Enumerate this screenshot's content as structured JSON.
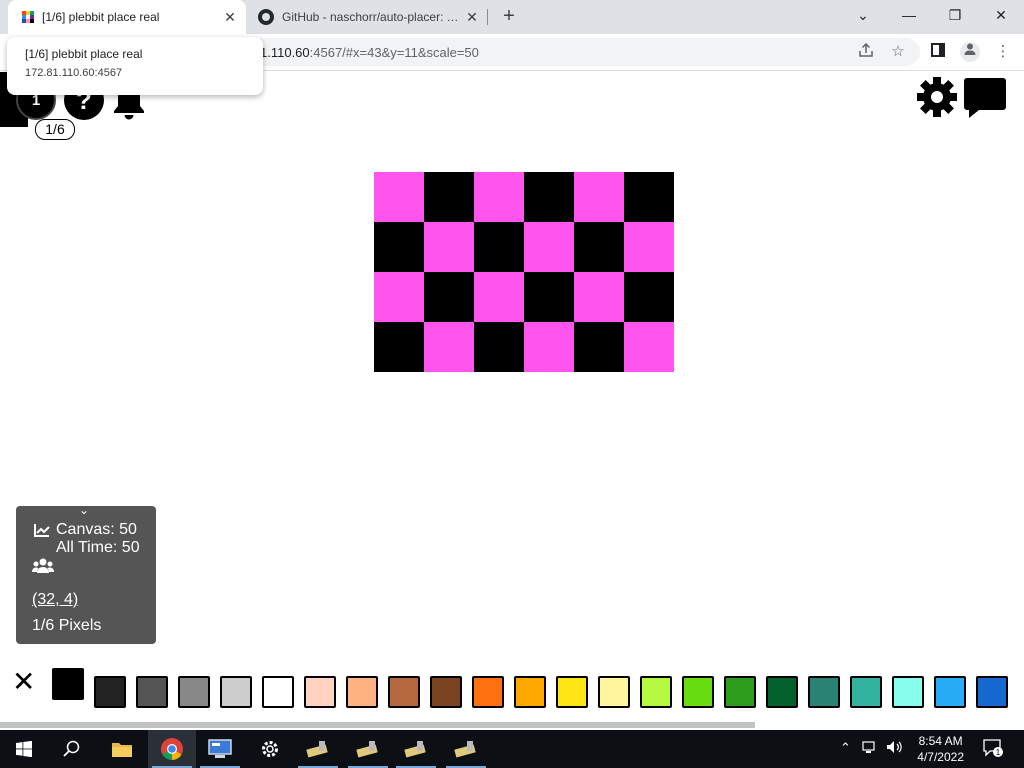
{
  "browser": {
    "tabs": [
      {
        "title": "[1/6] plebbit place real",
        "active": true
      },
      {
        "title": "GitHub - naschorr/auto-placer: Th",
        "active": false
      }
    ],
    "new_tab_label": "+",
    "close_glyph": "✕",
    "url_dim_prefix": "1.110.60",
    "url_rest": ":4567/#x=43&y=11&scale=50",
    "hover_card": {
      "title": "[1/6] plebbit place real",
      "url": "172.81.110.60:4567"
    },
    "window_controls": {
      "minimize": "—",
      "maximize": "❐",
      "close": "✕",
      "tab_list": "⌄"
    }
  },
  "page": {
    "account_label": "1",
    "help_label": "?",
    "pixel_badge": "1/6",
    "canvas": {
      "colors": {
        "pink": "#ff55ee",
        "black": "#000000"
      },
      "rows": [
        [
          "pink",
          "black",
          "pink",
          "black",
          "pink",
          "black"
        ],
        [
          "black",
          "pink",
          "black",
          "pink",
          "black",
          "pink"
        ],
        [
          "pink",
          "black",
          "pink",
          "black",
          "pink",
          "black"
        ],
        [
          "black",
          "pink",
          "black",
          "pink",
          "black",
          "pink"
        ]
      ]
    },
    "stats": {
      "canvas_line": "Canvas: 50",
      "alltime_line": "All Time: 50",
      "coords": "(32, 4)",
      "pixels": "1/6 Pixels"
    },
    "palette_close": "✕",
    "palette": [
      "#000000",
      "#222222",
      "#555555",
      "#888888",
      "#cdcdcd",
      "#ffffff",
      "#ffd3c0",
      "#ffb383",
      "#b5683e",
      "#7a4421",
      "#ff7011",
      "#ffa800",
      "#ffe416",
      "#fff69c",
      "#b5f942",
      "#68dd12",
      "#2e9d1d",
      "#03612e",
      "#298273",
      "#31b3a0",
      "#89fded",
      "#27acf5",
      "#1568d0",
      "#17196a"
    ],
    "selected_color": "#000000"
  },
  "taskbar": {
    "time": "8:54 AM",
    "date": "4/7/2022",
    "notification_count": "1"
  }
}
